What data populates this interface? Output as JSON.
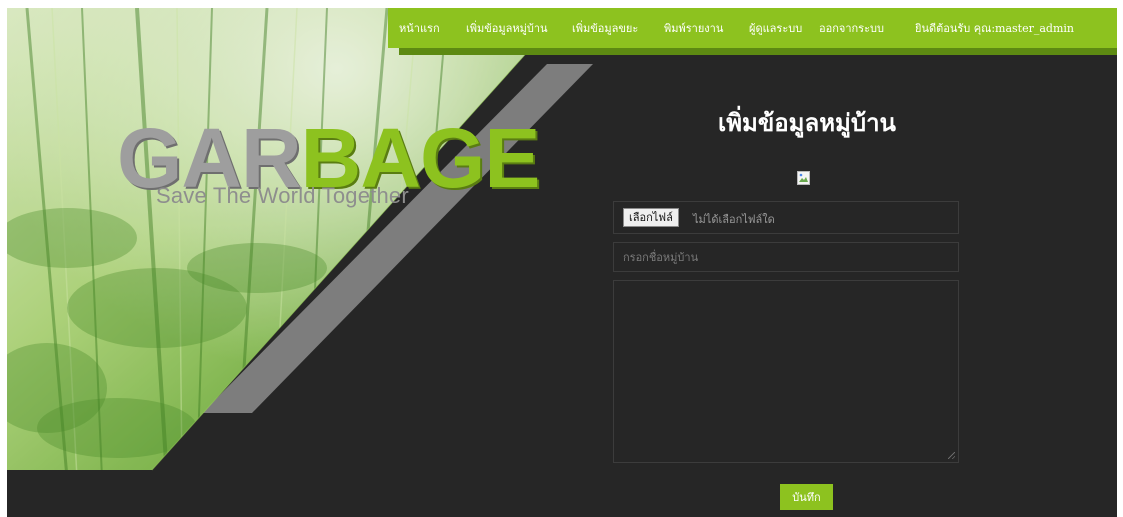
{
  "nav": {
    "items": [
      {
        "label": "หน้าแรก"
      },
      {
        "label": "เพิ่มข้อมูลหมู่บ้าน"
      },
      {
        "label": "เพิ่มข้อมูลขยะ"
      },
      {
        "label": "พิมพ์รายงาน"
      },
      {
        "label": "ผู้ดูแลระบบ"
      },
      {
        "label": "ออกจากระบบ"
      },
      {
        "label": "ยินดีต้อนรับ คุณ:master_admin"
      }
    ]
  },
  "hero": {
    "logo_part1": "GAR",
    "logo_part2": "BAGE",
    "tagline": "Save The World Together"
  },
  "form": {
    "title": "เพิ่มข้อมูลหมู่บ้าน",
    "file_button": "เลือกไฟล์",
    "file_status": "ไม่ได้เลือกไฟล์ใด",
    "name_placeholder": "กรอกชื่อหมู่บ้าน",
    "save_label": "บันทึก"
  },
  "colors": {
    "accent": "#8dc21f",
    "background": "#262626",
    "accent_dark": "#5d8a12"
  }
}
